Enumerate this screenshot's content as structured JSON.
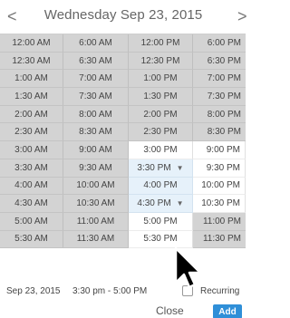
{
  "header": {
    "prev_label": "<",
    "title": "Wednesday Sep 23, 2015",
    "next_label": ">"
  },
  "grid": {
    "rows": [
      [
        "12:00 AM",
        "6:00 AM",
        "12:00 PM",
        "6:00 PM"
      ],
      [
        "12:30 AM",
        "6:30 AM",
        "12:30 PM",
        "6:30 PM"
      ],
      [
        "1:00 AM",
        "7:00 AM",
        "1:00 PM",
        "7:00 PM"
      ],
      [
        "1:30 AM",
        "7:30 AM",
        "1:30 PM",
        "7:30 PM"
      ],
      [
        "2:00 AM",
        "8:00 AM",
        "2:00 PM",
        "8:00 PM"
      ],
      [
        "2:30 AM",
        "8:30 AM",
        "2:30 PM",
        "8:30 PM"
      ],
      [
        "3:00 AM",
        "9:00 AM",
        "3:00 PM",
        "9:00 PM"
      ],
      [
        "3:30 AM",
        "9:30 AM",
        "3:30 PM",
        "9:30 PM"
      ],
      [
        "4:00 AM",
        "10:00 AM",
        "4:00 PM",
        "10:00 PM"
      ],
      [
        "4:30 AM",
        "10:30 AM",
        "4:30 PM",
        "10:30 PM"
      ],
      [
        "5:00 AM",
        "11:00 AM",
        "5:00 PM",
        "11:00 PM"
      ],
      [
        "5:30 AM",
        "11:30 AM",
        "5:30 PM",
        "11:30 PM"
      ]
    ],
    "free_cells": [
      [
        6,
        2
      ],
      [
        8,
        2
      ],
      [
        10,
        2
      ],
      [
        11,
        2
      ],
      [
        6,
        3
      ],
      [
        7,
        3
      ],
      [
        8,
        3
      ],
      [
        9,
        3
      ]
    ],
    "selected_cells": [
      [
        7,
        2
      ],
      [
        8,
        2
      ],
      [
        9,
        2
      ]
    ],
    "arrow_cells": [
      [
        7,
        2
      ],
      [
        9,
        2
      ]
    ],
    "arrow_glyph": "▼"
  },
  "summary": {
    "date": "Sep 23, 2015",
    "time_range": "3:30 pm - 5:00 PM",
    "recurring_label": "Recurring",
    "recurring_checked": false
  },
  "actions": {
    "close_label": "Close",
    "add_label": "Add"
  },
  "colors": {
    "busy_cell": "#d3d3d3",
    "free_cell": "#ffffff",
    "selected_cell": "#e6f1fa",
    "add_button": "#2f8fd8"
  },
  "icons": {
    "prev": "chevron-left-icon",
    "next": "chevron-right-icon",
    "dropdown": "triangle-down-icon",
    "cursor": "mouse-pointer-icon"
  }
}
